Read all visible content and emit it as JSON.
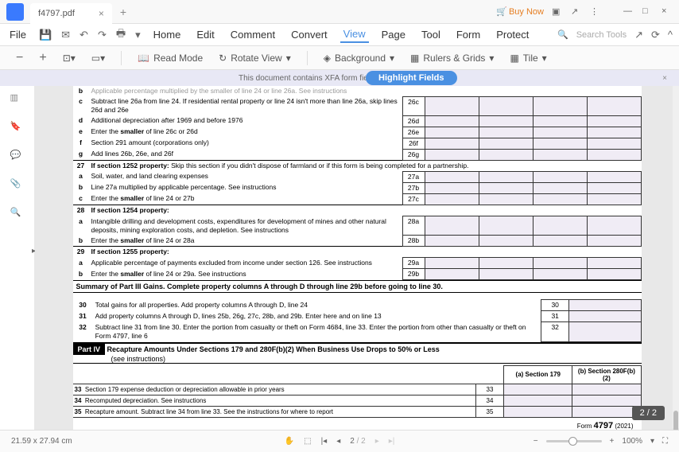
{
  "titlebar": {
    "filename": "f4797.pdf",
    "buynow": "Buy Now"
  },
  "menu": {
    "file": "File",
    "home": "Home",
    "edit": "Edit",
    "comment": "Comment",
    "convert": "Convert",
    "view": "View",
    "page": "Page",
    "tool": "Tool",
    "form": "Form",
    "protect": "Protect",
    "search": "Search Tools"
  },
  "ribbon": {
    "read": "Read Mode",
    "rotate": "Rotate View",
    "background": "Background",
    "rulers": "Rulers & Grids",
    "tile": "Tile"
  },
  "notice": {
    "text": "This document contains XFA form fields.",
    "highlight": "Highlight Fields"
  },
  "form": {
    "line_b": "Applicable percentage multiplied by the smaller of line 24 or line 26a. See instructions",
    "line_c": "Subtract line 26a from line 24. If residential rental property or line 24 isn't more than line 26a, skip lines 26d and 26e",
    "line_d": "Additional depreciation after 1969 and before 1976",
    "line_e_pre": "Enter the ",
    "line_e_bold": "smaller",
    "line_e_post": " of line 26c or 26d",
    "line_f": "Section 291 amount (corporations only)",
    "line_g": "Add lines 26b, 26e, and 26f",
    "line_27": "27",
    "line_27_bold": "If section 1252 property:",
    "line_27_text": "  Skip this section if you didn't dispose of farmland or if this form is being completed for a partnership.",
    "line_27a": "Soil, water, and land clearing expenses",
    "line_27b": "Line 27a multiplied by applicable percentage. See instructions",
    "line_27c_pre": "Enter the ",
    "line_27c_bold": "smaller",
    "line_27c_post": " of line 24 or 27b",
    "line_28": "28",
    "line_28_bold": "If section 1254 property:",
    "line_28a": "Intangible drilling and development costs, expenditures for development of mines and other natural deposits,  mining exploration costs, and depletion. See instructions",
    "line_28b_pre": "Enter the ",
    "line_28b_bold": "smaller",
    "line_28b_post": " of line 24 or 28a",
    "line_29": "29",
    "line_29_bold": "If section 1255 property:",
    "line_29a": "Applicable percentage of payments excluded from income under section 126. See instructions",
    "line_29b_pre": "Enter the ",
    "line_29b_bold": "smaller",
    "line_29b_post": " of line 24 or 29a. See instructions",
    "summary_bold": "Summary of Part III Gains.",
    "summary_text": "  Complete property columns A through D through line 29b before going to line 30.",
    "line_30": "30",
    "line_30_text": "Total gains for all properties. Add property columns A through D, line 24",
    "line_31": "31",
    "line_31_text": "Add property columns A through D, lines 25b, 26g, 27c, 28b, and 29b. Enter here and on line 13",
    "line_32": "32",
    "line_32_text": "Subtract line 31 from line 30. Enter the portion from casualty or theft on Form 4684, line 33. Enter the portion from  other than casualty or theft on Form 4797, line 6",
    "part4": "Part IV",
    "part4_title": "Recapture Amounts Under Sections 179 and 280F(b)(2) When Business Use Drops to 50% or Less",
    "part4_sub": "(see instructions)",
    "col_a": "(a) Section 179",
    "col_b": "(b) Section 280F(b)(2)",
    "line_33": "33",
    "line_33_text": "Section 179 expense deduction or depreciation allowable in prior years",
    "line_34": "34",
    "line_34_text": "Recomputed depreciation. See instructions",
    "line_35": "35",
    "line_35_text": "Recapture amount. Subtract line 34 from line 33. See the instructions for where to report",
    "footer_form": "Form ",
    "footer_num": "4797",
    "footer_year": " (2021)",
    "labels": {
      "26c": "26c",
      "26d": "26d",
      "26e": "26e",
      "26f": "26f",
      "26g": "26g",
      "27a": "27a",
      "27b": "27b",
      "27c": "27c",
      "28a": "28a",
      "28b": "28b",
      "29a": "29a",
      "29b": "29b",
      "30": "30",
      "31": "31",
      "32": "32",
      "33": "33",
      "34": "34",
      "35": "35"
    }
  },
  "status": {
    "dims": "21.59 x 27.94 cm",
    "page": "2",
    "total": "/ 2",
    "zoom": "100%",
    "badge": "2 / 2"
  }
}
